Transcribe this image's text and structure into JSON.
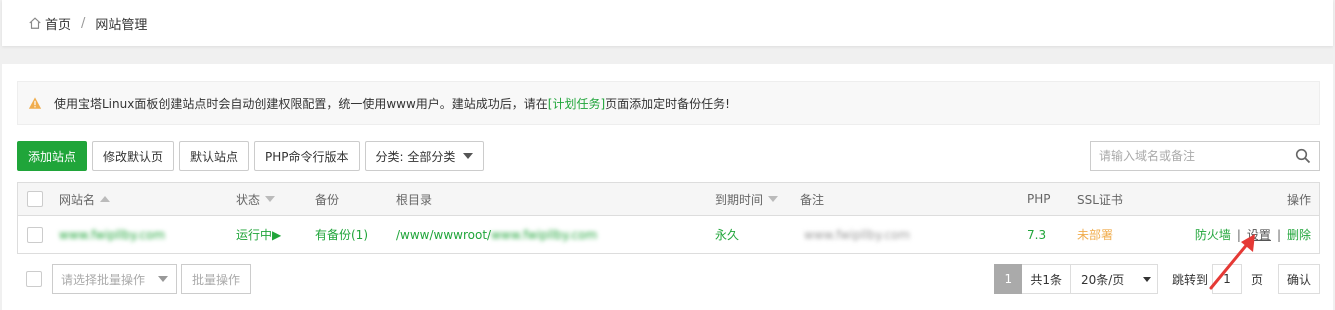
{
  "breadcrumb": {
    "home": "首页",
    "separator": "/",
    "current": "网站管理"
  },
  "notice": {
    "before": "使用宝塔Linux面板创建站点时会自动创建权限配置，统一使用www用户。建站成功后，请在",
    "link": "[计划任务]",
    "after": "页面添加定时备份任务!"
  },
  "toolbar": {
    "add_site": "添加站点",
    "modify_default_page": "修改默认页",
    "default_site": "默认站点",
    "php_cli_version": "PHP命令行版本",
    "category_select": "分类: 全部分类"
  },
  "search": {
    "placeholder": "请输入域名或备注"
  },
  "table": {
    "headers": {
      "site_name": "网站名",
      "status": "状态",
      "backup": "备份",
      "root_dir": "根目录",
      "expire": "到期时间",
      "remark": "备注",
      "php": "PHP",
      "ssl": "SSL证书",
      "actions": "操作"
    },
    "rows": [
      {
        "site_name": "www.fwipllby.com",
        "status": "运行中▶",
        "backup": "有备份(1)",
        "root_prefix": "/www/wwwroot/",
        "root_suffix": "www.fwipllby.com",
        "expire": "永久",
        "remark": "www.fwipllby.com",
        "php": "7.3",
        "ssl": "未部署",
        "action_firewall": "防火墙",
        "action_settings": "设置",
        "action_delete": "删除",
        "action_separator": "|"
      }
    ]
  },
  "footer": {
    "batch_placeholder": "请选择批量操作",
    "batch_button": "批量操作",
    "pager": {
      "current_page": "1",
      "total": "共1条",
      "page_size": "20条/页",
      "jump_label": "跳转到",
      "jump_value": "1",
      "page_unit": "页",
      "confirm": "确认"
    }
  },
  "colors": {
    "accent": "#20a53a",
    "warning": "#f0ad4e"
  }
}
